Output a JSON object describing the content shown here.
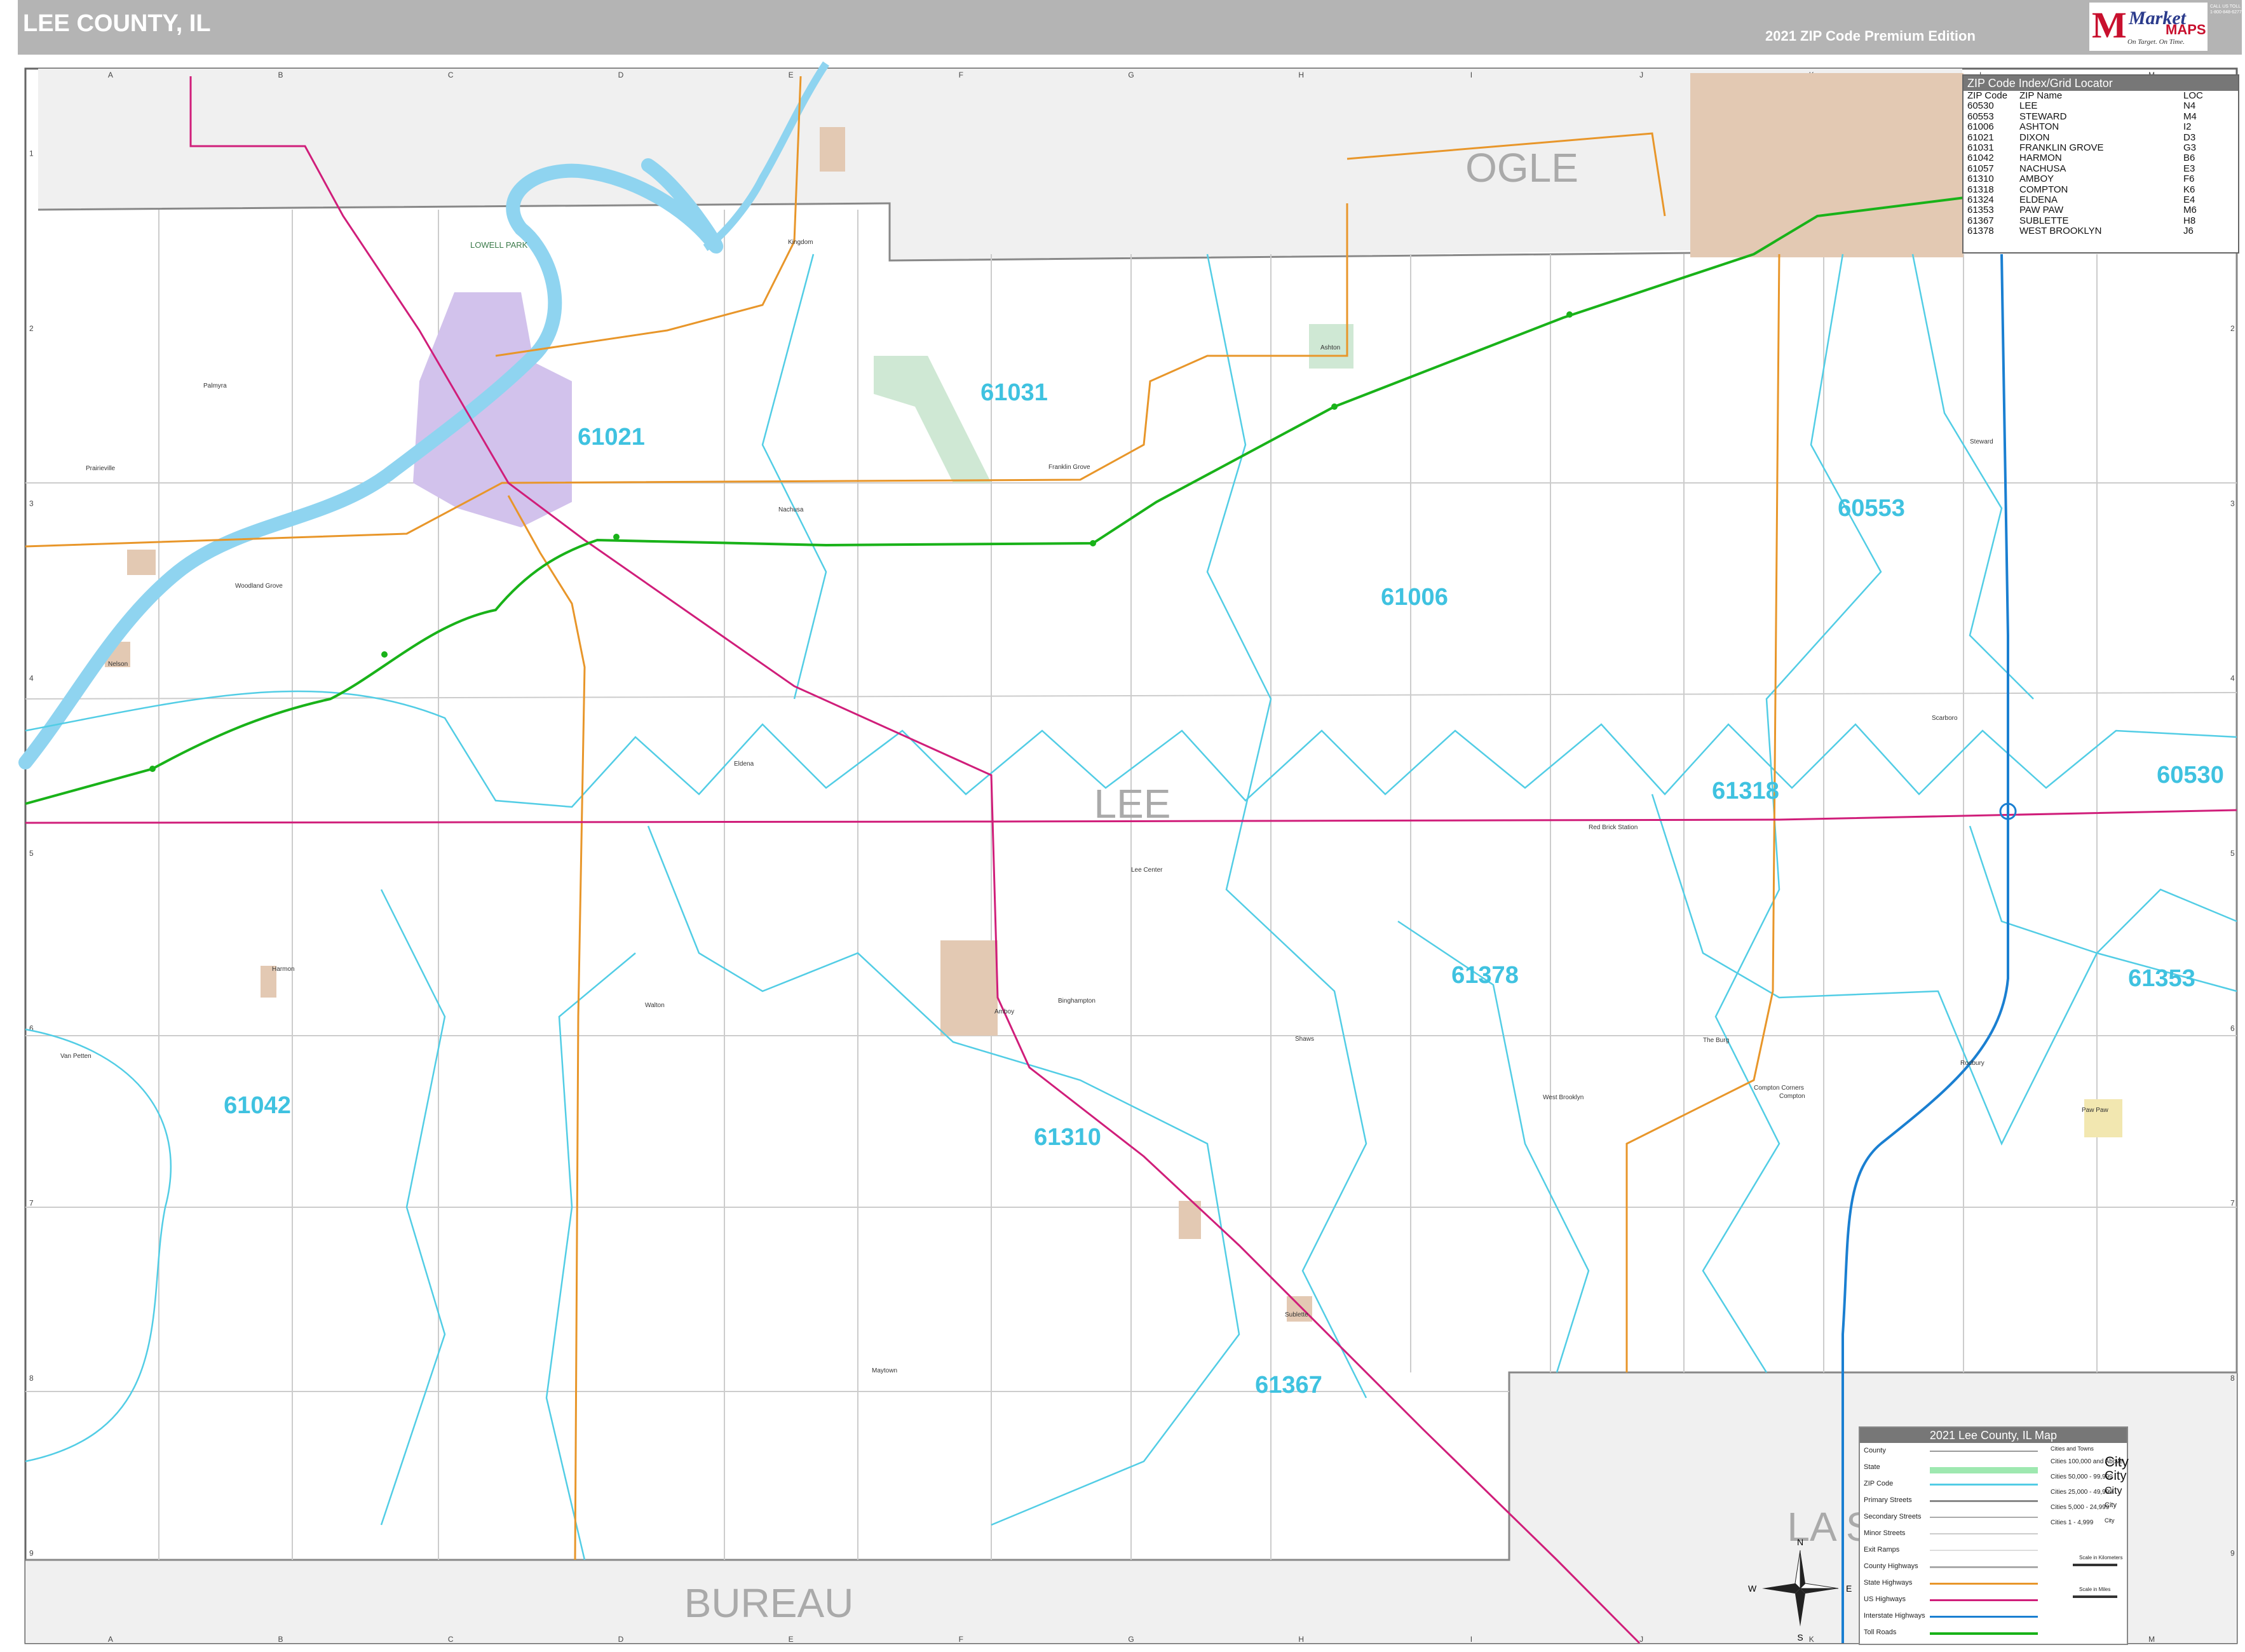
{
  "header": {
    "title": "LEE COUNTY, IL",
    "edition": "2021 ZIP Code Premium Edition",
    "logo_brand": "Market",
    "logo_maps": "MAPS",
    "logo_tagline": "On Target.  On Time.",
    "contact_lines": [
      "CALL US TOLL FREE",
      "1-800-848-6277"
    ]
  },
  "colors": {
    "header_bg": "#b4b4b4",
    "zip_boundary": "#52cde5",
    "interstate": "#1a7fd1",
    "us_highway": "#d01e7a",
    "state_highway": "#e8962a",
    "toll_road": "#19b219",
    "water": "#8fd4f0",
    "urban": "#e3c9b3",
    "city_purple": "#d2c2ec",
    "park": "#cfe8d4",
    "outside_county": "#f0f0f0"
  },
  "grid": {
    "columns": [
      "A",
      "B",
      "C",
      "D",
      "E",
      "F",
      "G",
      "H",
      "I",
      "J",
      "K",
      "L",
      "M"
    ],
    "rows": [
      "1",
      "2",
      "3",
      "4",
      "5",
      "6",
      "7",
      "8",
      "9"
    ]
  },
  "county_labels": [
    {
      "name": "LEE",
      "big": true
    },
    {
      "name": "OGLE",
      "big": true
    },
    {
      "name": "BUREAU",
      "big": true
    },
    {
      "name": "LA S",
      "big": true
    }
  ],
  "zip_labels": [
    "61031",
    "61021",
    "60553",
    "61006",
    "61318",
    "60530",
    "61378",
    "61353",
    "61042",
    "61310",
    "61367"
  ],
  "place_labels": [
    "LOWELL PARK",
    "Kingdom",
    "Palmyra",
    "Prairieville",
    "Woodland Grove",
    "Nelson",
    "Eldena",
    "Nachusa",
    "Franklin Grove",
    "Harmon",
    "Walton",
    "Van Petten",
    "Amboy",
    "Binghampton",
    "Lee Center",
    "Shaws",
    "West Brooklyn",
    "The Burg",
    "Compton",
    "Scarboro",
    "Paw Paw",
    "Rodbury",
    "Sublette",
    "Maytown",
    "Steward",
    "Ashton",
    "Red Brick Station",
    "Compton Corners"
  ],
  "zip_index": {
    "title": "ZIP Code Index/Grid Locator",
    "headers": [
      "ZIP Code",
      "ZIP Name",
      "LOC"
    ],
    "rows": [
      [
        "60530",
        "LEE",
        "N4"
      ],
      [
        "60553",
        "STEWARD",
        "M4"
      ],
      [
        "61006",
        "ASHTON",
        "I2"
      ],
      [
        "61021",
        "DIXON",
        "D3"
      ],
      [
        "61031",
        "FRANKLIN GROVE",
        "G3"
      ],
      [
        "61042",
        "HARMON",
        "B6"
      ],
      [
        "61057",
        "NACHUSA",
        "E3"
      ],
      [
        "61310",
        "AMBOY",
        "F6"
      ],
      [
        "61318",
        "COMPTON",
        "K6"
      ],
      [
        "61324",
        "ELDENA",
        "E4"
      ],
      [
        "61353",
        "PAW PAW",
        "M6"
      ],
      [
        "61367",
        "SUBLETTE",
        "H8"
      ],
      [
        "61378",
        "WEST BROOKLYN",
        "J6"
      ]
    ]
  },
  "legend": {
    "title": "2021 Lee County, IL Map",
    "items": [
      "County",
      "State",
      "ZIP Code",
      "Primary Streets",
      "Secondary Streets",
      "Minor Streets",
      "Exit Ramps",
      "County Highways",
      "State Highways",
      "US Highways",
      "Interstate Highways",
      "Toll Roads"
    ],
    "cities_header": "Cities and Towns",
    "city_tiers": [
      {
        "range": "Cities 100,000 and Above",
        "sample": "City"
      },
      {
        "range": "Cities 50,000 - 99,999",
        "sample": "City"
      },
      {
        "range": "Cities 25,000 - 49,999",
        "sample": "City"
      },
      {
        "range": "Cities 5,000 - 24,999",
        "sample": "City"
      },
      {
        "range": "Cities 1 - 4,999",
        "sample": "City"
      }
    ],
    "scale_km": "Scale in Kilometers",
    "scale_mi": "Scale in Miles"
  },
  "compass": {
    "n": "N",
    "s": "S",
    "e": "E",
    "w": "W"
  }
}
